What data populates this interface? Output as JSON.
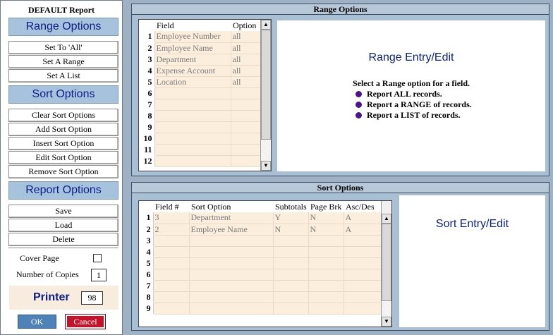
{
  "report_title": "DEFAULT Report",
  "sections": {
    "range": "Range Options",
    "sort": "Sort Options",
    "report": "Report Options"
  },
  "range_buttons": [
    "Set To 'All'",
    "Set A Range",
    "Set A List"
  ],
  "sort_buttons": [
    "Clear Sort Options",
    "Add Sort Option",
    "Insert Sort Option",
    "Edit Sort Option",
    "Remove Sort Option"
  ],
  "report_buttons": [
    "Save",
    "Load",
    "Delete"
  ],
  "cover_page_label": "Cover Page",
  "copies_label": "Number of Copies",
  "copies_value": "1",
  "printer_label": "Printer",
  "printer_value": "98",
  "ok_label": "OK",
  "cancel_label": "Cancel",
  "range_panel": {
    "title": "Range Options",
    "headers": [
      "Field",
      "Option"
    ],
    "rows": [
      {
        "n": "1",
        "field": "Employee Number",
        "option": "all"
      },
      {
        "n": "2",
        "field": "Employee Name",
        "option": "all"
      },
      {
        "n": "3",
        "field": "Department",
        "option": "all"
      },
      {
        "n": "4",
        "field": "Expense Account",
        "option": "all"
      },
      {
        "n": "5",
        "field": "Location",
        "option": "all"
      },
      {
        "n": "6",
        "field": "",
        "option": ""
      },
      {
        "n": "7",
        "field": "",
        "option": ""
      },
      {
        "n": "8",
        "field": "",
        "option": ""
      },
      {
        "n": "9",
        "field": "",
        "option": ""
      },
      {
        "n": "10",
        "field": "",
        "option": ""
      },
      {
        "n": "11",
        "field": "",
        "option": ""
      },
      {
        "n": "12",
        "field": "",
        "option": ""
      }
    ],
    "info_title": "Range Entry/Edit",
    "info_sub": "Select a Range option for a field.",
    "bullets": [
      "Report ALL records.",
      "Report a RANGE of records.",
      "Report a LIST of records."
    ]
  },
  "sort_panel": {
    "title": "Sort Options",
    "headers": [
      "Field #",
      "Sort Option",
      "Subtotals",
      "Page Brk",
      "Asc/Des"
    ],
    "rows": [
      {
        "n": "1",
        "field": "3",
        "sort": "Department",
        "sub": "Y",
        "brk": "N",
        "asc": "A"
      },
      {
        "n": "2",
        "field": "2",
        "sort": "Employee Name",
        "sub": "N",
        "brk": "N",
        "asc": "A"
      },
      {
        "n": "3",
        "field": "",
        "sort": "",
        "sub": "",
        "brk": "",
        "asc": ""
      },
      {
        "n": "4",
        "field": "",
        "sort": "",
        "sub": "",
        "brk": "",
        "asc": ""
      },
      {
        "n": "5",
        "field": "",
        "sort": "",
        "sub": "",
        "brk": "",
        "asc": ""
      },
      {
        "n": "6",
        "field": "",
        "sort": "",
        "sub": "",
        "brk": "",
        "asc": ""
      },
      {
        "n": "7",
        "field": "",
        "sort": "",
        "sub": "",
        "brk": "",
        "asc": ""
      },
      {
        "n": "8",
        "field": "",
        "sort": "",
        "sub": "",
        "brk": "",
        "asc": ""
      },
      {
        "n": "9",
        "field": "",
        "sort": "",
        "sub": "",
        "brk": "",
        "asc": ""
      }
    ],
    "info_title": "Sort Entry/Edit"
  }
}
